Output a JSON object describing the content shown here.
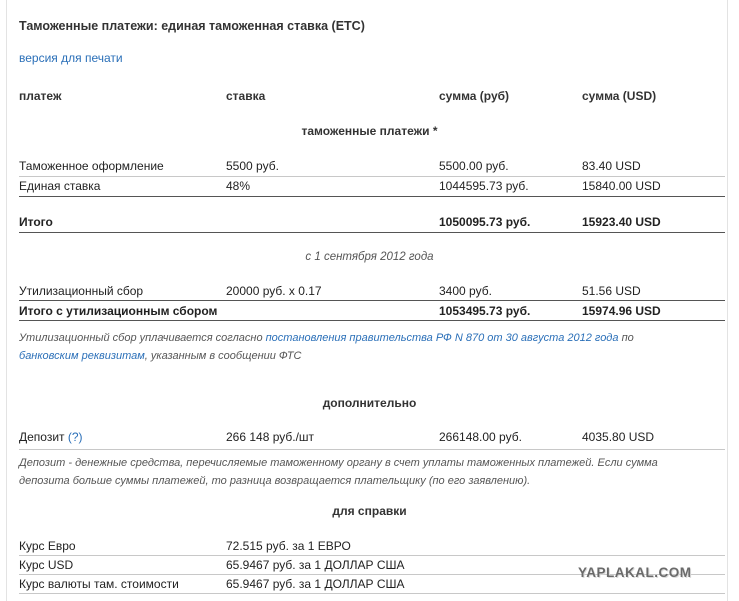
{
  "title": "Таможенные платежи: единая таможенная ставка (ЕТС)",
  "print_link": "версия для печати",
  "headers": {
    "payment": "платеж",
    "rate": "ставка",
    "sum_rub": "сумма (руб)",
    "sum_usd": "сумма (USD)"
  },
  "customs_section": "таможенные платежи *",
  "customs_rows": [
    {
      "name": "Таможенное оформление",
      "rate": "5500 руб.",
      "rub": "5500.00 руб.",
      "usd": "83.40 USD"
    },
    {
      "name": "Единая ставка",
      "rate": "48%",
      "rub": "1044595.73 руб.",
      "usd": "15840.00 USD"
    }
  ],
  "total": {
    "name": "Итого",
    "rate": "",
    "rub": "1050095.73 руб.",
    "usd": "15923.40 USD"
  },
  "since_note": "с 1 сентября 2012 года",
  "recycling_row": {
    "name": "Утилизационный сбор",
    "rate": "20000 руб. x 0.17",
    "rub": "3400 руб.",
    "usd": "51.56 USD"
  },
  "total_with_recycling": {
    "name": "Итого с утилизационным сбором",
    "rate": "",
    "rub": "1053495.73 руб.",
    "usd": "15974.96 USD"
  },
  "recycling_note": {
    "prefix": "Утилизационный сбор уплачивается согласно ",
    "link1": "постановления правительства РФ N 870 от 30 августа 2012 года",
    "mid": " по ",
    "link2": "банковским реквизитам",
    "suffix": ", указанным в сообщении ФТС"
  },
  "additional_section": "дополнительно",
  "deposit_row": {
    "name": "Депозит",
    "help": "(?)",
    "rate": "266 148 руб./шт",
    "rub": "266148.00 руб.",
    "usd": "4035.80 USD"
  },
  "deposit_note": "Депозит - денежные средства, перечисляемые таможенному органу в счет уплаты таможенных платежей. Если сумма депозита больше суммы платежей, то разница возвращается плательщику (по его заявлению).",
  "reference_section": "для справки",
  "reference_rows": [
    {
      "name": "Курс Евро",
      "value": "72.515 руб. за 1 ЕВРО"
    },
    {
      "name": "Курс USD",
      "value": "65.9467 руб. за 1 ДОЛЛАР США"
    },
    {
      "name": "Курс валюты там. стоимости",
      "value": "65.9467 руб. за 1 ДОЛЛАР США"
    }
  ],
  "watermark": "YAPLAKAL.COM"
}
